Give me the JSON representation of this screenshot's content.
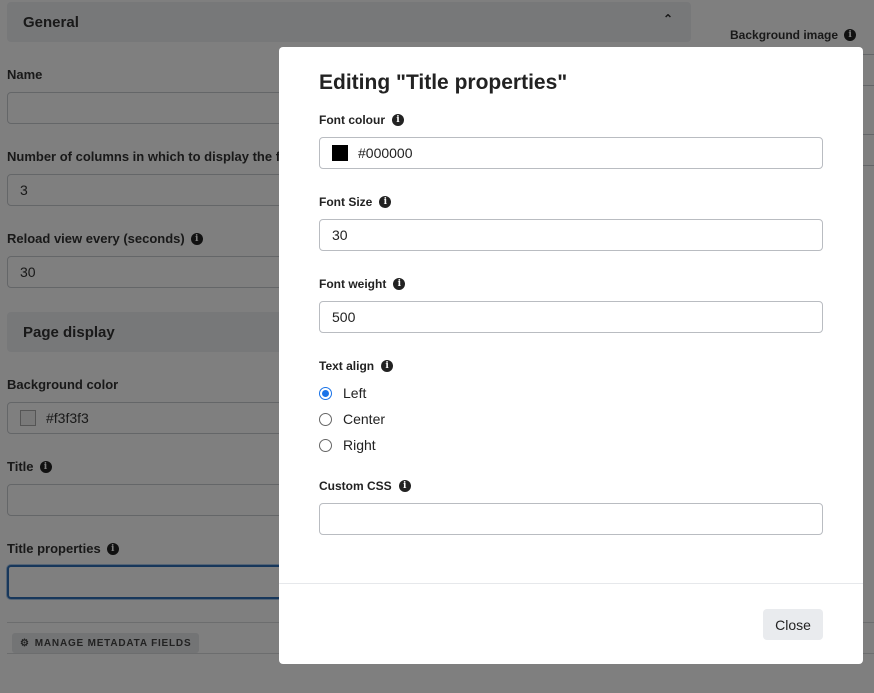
{
  "background": {
    "general_header": "General",
    "name_label": "Name",
    "columns_label": "Number of columns in which to display the fee",
    "columns_value": "3",
    "reload_label": "Reload view every (seconds)",
    "reload_value": "30",
    "page_display_header": "Page display",
    "bg_color_label": "Background color",
    "bg_color_value": "#f3f3f3",
    "title_label": "Title",
    "title_props_label": "Title properties",
    "manage_button": "MANAGE METADATA FIELDS",
    "bg_image_label": "Background image"
  },
  "modal": {
    "title": "Editing \"Title properties\"",
    "font_colour_label": "Font colour",
    "font_colour_value": "#000000",
    "font_size_label": "Font Size",
    "font_size_value": "30",
    "font_weight_label": "Font weight",
    "font_weight_value": "500",
    "text_align_label": "Text align",
    "align_options": [
      "Left",
      "Center",
      "Right"
    ],
    "align_selected": "Left",
    "custom_css_label": "Custom CSS",
    "custom_css_value": "",
    "close_label": "Close"
  },
  "colors": {
    "accent": "#1a73e8",
    "swatch_black": "#000000",
    "swatch_bg": "#f3f3f3"
  }
}
